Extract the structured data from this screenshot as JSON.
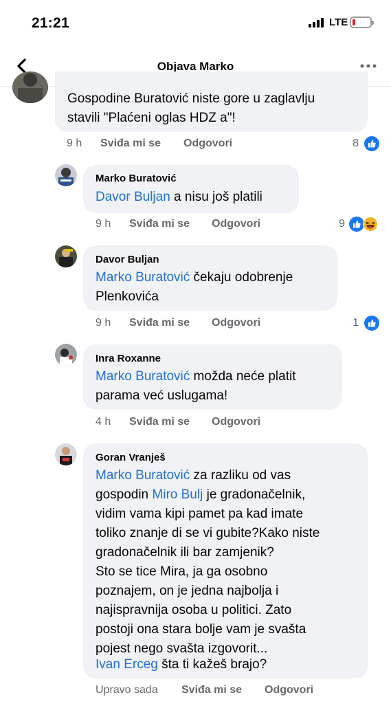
{
  "status": {
    "time": "21:21",
    "network": "LTE"
  },
  "header": {
    "title": "Objava Marko"
  },
  "labels": {
    "like": "Sviđa mi se",
    "reply": "Odgovori"
  },
  "comments": [
    {
      "author": "",
      "lines": [
        "Gospodine Buratović niste gore u zaglavlju",
        "stavili \"Plaćeni oglas HDZ a\"!"
      ],
      "time": "9 h",
      "reaction_count": "8",
      "reactions": [
        "like-icon"
      ]
    },
    {
      "author": "Marko Buratović",
      "mention": "Davor Buljan",
      "text_after_mention": " a nisu još platili",
      "time": "9 h",
      "reaction_count": "9",
      "reactions": [
        "like-icon",
        "haha-icon"
      ]
    },
    {
      "author": "Davor Buljan",
      "mention": "Marko Buratović",
      "text_after_mention": " čekaju odobrenje",
      "line2": "Plenkovića",
      "time": "9 h",
      "reaction_count": "1",
      "reactions": [
        "like-icon"
      ]
    },
    {
      "author": "Inra Roxanne",
      "mention": "Marko Buratović",
      "text_after_mention": " možda neće platit",
      "line2": "parama već uslugama!",
      "time": "4 h"
    },
    {
      "author": "Goran Vranješ",
      "mention": "Marko Buratović",
      "text_after_mention": " za razliku od vas",
      "line2_before": "gospodin ",
      "mention2": "Miro Bulj",
      "line2_after": " je gradonačelnik,",
      "lines": [
        "vidim vama kipi pamet pa kad imate",
        "toliko znanje di se vi gubite?Kako niste",
        "gradonačelnik ili bar zamjenik?",
        "Sto se tice Mira, ja ga osobno",
        "poznajem, on je jedna najbolja i",
        "najispravnija osoba u politici. Zato",
        "postoji ona stara bolje vam je svašta",
        "pojest nego svašta izgovorit..."
      ],
      "mention3": "Ivan Erceg",
      "last_after": " šta ti kažeš brajo?",
      "time": "Upravo sada"
    }
  ],
  "colors": {
    "link": "#216fdb",
    "bubble": "#f0f2f5",
    "meta": "#65676b",
    "like": "#1877f2",
    "haha": "#f7b125"
  }
}
